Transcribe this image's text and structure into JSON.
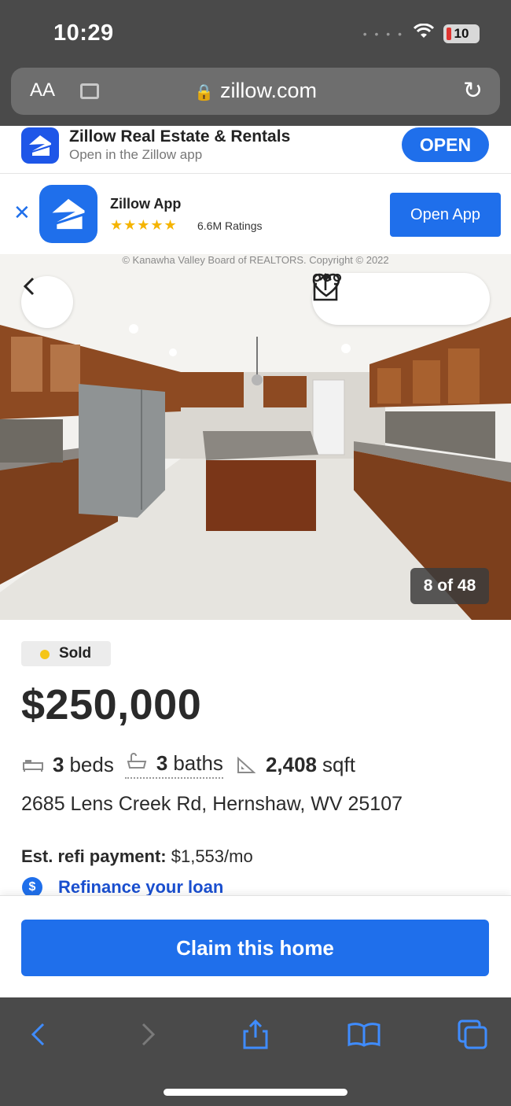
{
  "status_bar": {
    "time": "10:29",
    "battery": "10"
  },
  "browser": {
    "text_size": "AA",
    "host": "zillow.com"
  },
  "smart_banner": {
    "title": "Zillow Real Estate & Rentals",
    "subtitle": "Open in the Zillow app",
    "open_label": "OPEN"
  },
  "app_banner": {
    "title": "Zillow App",
    "stars": "★★★★★",
    "ratings": "6.6M Ratings",
    "button_label": "Open App"
  },
  "photo": {
    "copyright": "© Kanawha Valley Board of REALTORS. Copyright © 2022",
    "counter": "8 of 48"
  },
  "listing": {
    "status": "Sold",
    "price": "$250,000",
    "beds_value": "3",
    "beds_unit": "beds",
    "baths_value": "3",
    "baths_unit": "baths",
    "sqft_value": "2,408",
    "sqft_unit": "sqft",
    "address": "2685 Lens Creek Rd, Hernshaw, WV 25107",
    "refi_label": "Est. refi payment:",
    "refi_value": "$1,553/mo",
    "refi_link": "Refinance your loan",
    "coin_symbol": "$"
  },
  "cta": {
    "claim_label": "Claim this home"
  },
  "colors": {
    "zillow_blue": "#1f6feb",
    "sold_dot": "#f5c518",
    "chrome_gray": "#4a4a4a"
  }
}
